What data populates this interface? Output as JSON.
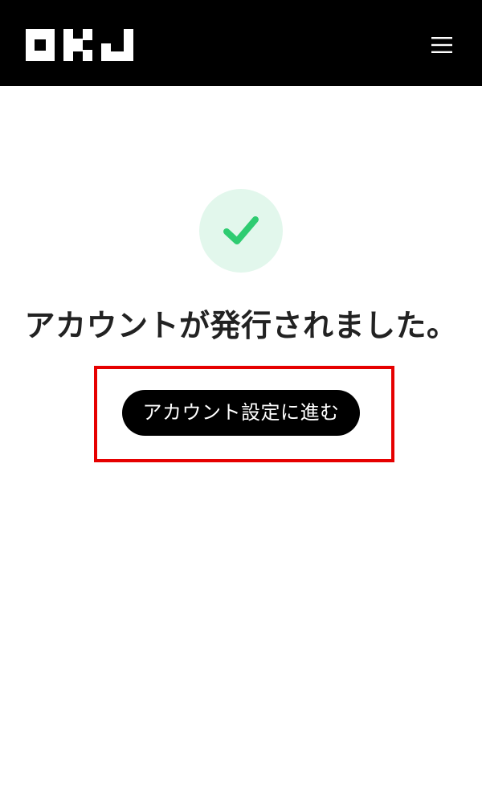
{
  "header": {
    "logo_text": "OKJ",
    "menu_icon": "hamburger-menu-icon"
  },
  "main": {
    "status_icon": "checkmark-icon",
    "message": "アカウントが発行されました。",
    "cta_label": "アカウント設定に進む"
  },
  "colors": {
    "header_bg": "#000000",
    "check_green": "#2ecc71",
    "check_circle_bg": "#e2f7ec",
    "button_bg": "#000000",
    "highlight": "#e60000"
  }
}
